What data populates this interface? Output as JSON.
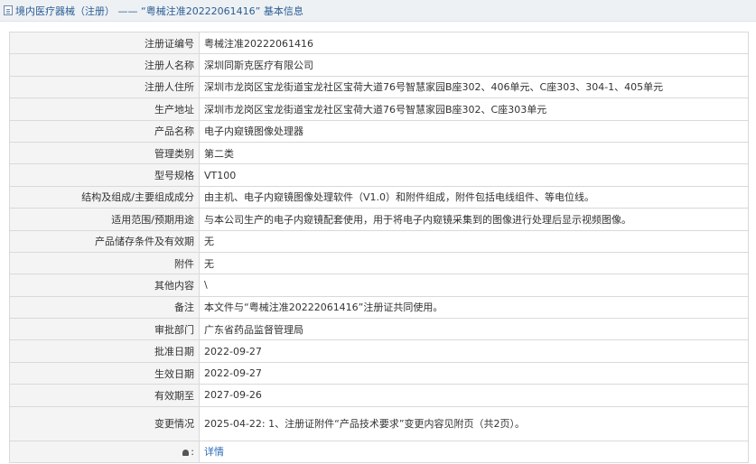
{
  "header": {
    "title": "境内医疗器械（注册） —— “粤械注准20222061416” 基本信息"
  },
  "rows": [
    {
      "label": "注册证编号",
      "value": "粤械注准20222061416"
    },
    {
      "label": "注册人名称",
      "value": "深圳同斯克医疗有限公司"
    },
    {
      "label": "注册人住所",
      "value": "深圳市龙岗区宝龙街道宝龙社区宝荷大道76号智慧家园B座302、406单元、C座303、304-1、405单元"
    },
    {
      "label": "生产地址",
      "value": "深圳市龙岗区宝龙街道宝龙社区宝荷大道76号智慧家园B座302、C座303单元"
    },
    {
      "label": "产品名称",
      "value": "电子内窥镜图像处理器"
    },
    {
      "label": "管理类别",
      "value": "第二类"
    },
    {
      "label": "型号规格",
      "value": "VT100"
    },
    {
      "label": "结构及组成/主要组成成分",
      "value": "由主机、电子内窥镜图像处理软件（V1.0）和附件组成，附件包括电线组件、等电位线。"
    },
    {
      "label": "适用范围/预期用途",
      "value": "与本公司生产的电子内窥镜配套使用，用于将电子内窥镜采集到的图像进行处理后显示视频图像。"
    },
    {
      "label": "产品储存条件及有效期",
      "value": "无"
    },
    {
      "label": "附件",
      "value": "无"
    },
    {
      "label": "其他内容",
      "value": "\\"
    },
    {
      "label": "备注",
      "value": "本文件与“粤械注准20222061416”注册证共同使用。"
    },
    {
      "label": "审批部门",
      "value": "广东省药品监督管理局"
    },
    {
      "label": "批准日期",
      "value": "2022-09-27"
    },
    {
      "label": "生效日期",
      "value": "2022-09-27"
    },
    {
      "label": "有效期至",
      "value": "2027-09-26"
    },
    {
      "label": "变更情况",
      "value": "2025-04-22: 1、注册证附件“产品技术要求”变更内容见附页（共2页）。"
    }
  ],
  "footer": {
    "icon": "lock-icon",
    "link_label": "详情"
  }
}
